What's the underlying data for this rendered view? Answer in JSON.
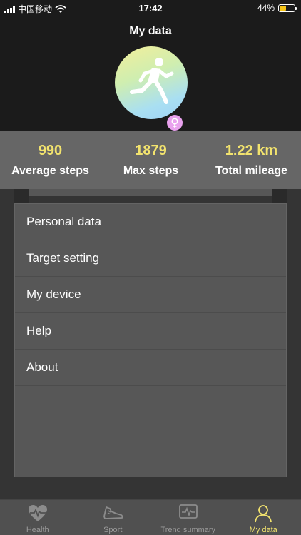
{
  "status_bar": {
    "carrier": "中国移动",
    "time": "17:42",
    "battery_percent": "44%",
    "battery_level": 0.44
  },
  "header": {
    "title": "My data",
    "avatar_icon": "runner-icon",
    "gender_icon": "female-icon"
  },
  "stats": [
    {
      "value": "990",
      "label": "Average steps"
    },
    {
      "value": "1879",
      "label": "Max steps"
    },
    {
      "value": "1.22 km",
      "label": "Total mileage"
    }
  ],
  "menu": [
    {
      "label": "Personal data"
    },
    {
      "label": "Target setting"
    },
    {
      "label": "My device"
    },
    {
      "label": "Help"
    },
    {
      "label": "About"
    }
  ],
  "tabbar": [
    {
      "label": "Health",
      "icon": "heart-pulse-icon",
      "active": false
    },
    {
      "label": "Sport",
      "icon": "shoe-icon",
      "active": false
    },
    {
      "label": "Trend summary",
      "icon": "trend-chart-icon",
      "active": false
    },
    {
      "label": "My data",
      "icon": "user-icon",
      "active": true
    }
  ],
  "colors": {
    "accent": "#f2e36e",
    "header_bg": "#1b1b1b",
    "stats_bg": "#666666",
    "panel_bg": "#575757",
    "tab_inactive": "#9a9a9a"
  }
}
